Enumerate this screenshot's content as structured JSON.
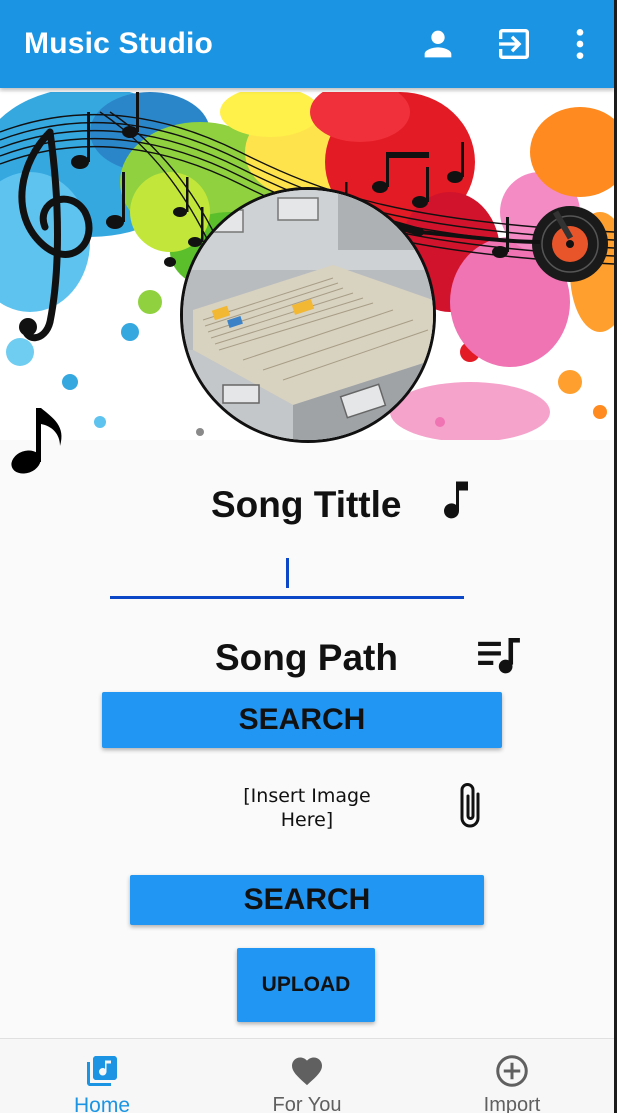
{
  "app": {
    "title": "Music Studio",
    "accent_color": "#1b95e3",
    "icons": [
      "account-icon",
      "login-icon",
      "more-vert-icon"
    ]
  },
  "form": {
    "song_title_label": "Song Tittle",
    "song_title_value": "",
    "song_path_label": "Song Path",
    "search_button_1": "SEARCH",
    "image_placeholder": "[Insert Image Here]",
    "search_button_2": "SEARCH",
    "upload_button": "UPLOAD",
    "input_underline_color": "#0b47c7",
    "button_color": "#2196f3"
  },
  "bottom_nav": {
    "items": [
      {
        "label": "Home",
        "icon": "library-music-icon",
        "active": true
      },
      {
        "label": "For You",
        "icon": "heart-icon",
        "active": false
      },
      {
        "label": "Import",
        "icon": "add-circle-icon",
        "active": false
      }
    ]
  }
}
